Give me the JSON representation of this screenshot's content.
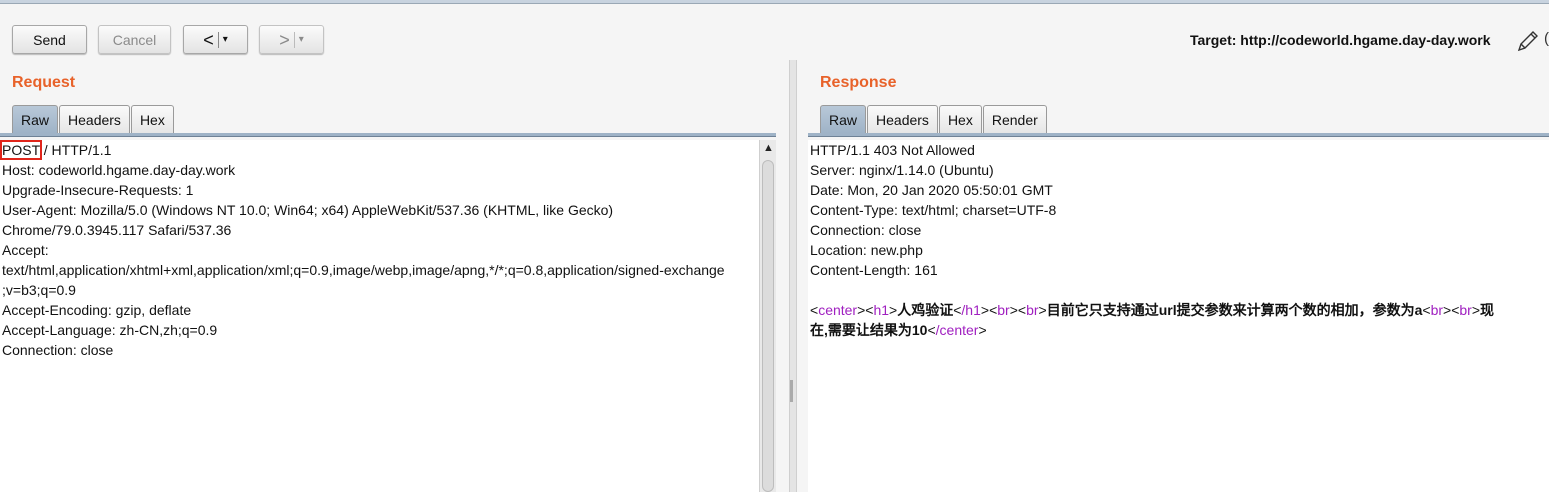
{
  "toolbar": {
    "send_label": "Send",
    "cancel_label": "Cancel",
    "back_label": "<",
    "forward_label": ">",
    "dropdown_label": "▾",
    "target_label": "Target: http://codeworld.hgame.day-day.work"
  },
  "request": {
    "title": "Request",
    "tabs": [
      "Raw",
      "Headers",
      "Hex"
    ],
    "active_tab": "Raw",
    "method": "POST",
    "first_line_rest": " / HTTP/1.1",
    "lines": [
      "Host: codeworld.hgame.day-day.work",
      "Upgrade-Insecure-Requests: 1",
      "User-Agent: Mozilla/5.0 (Windows NT 10.0; Win64; x64) AppleWebKit/537.36 (KHTML, like Gecko)",
      "Chrome/79.0.3945.117 Safari/537.36",
      "Accept:",
      "text/html,application/xhtml+xml,application/xml;q=0.9,image/webp,image/apng,*/*;q=0.8,application/signed-exchange",
      ";v=b3;q=0.9",
      "Accept-Encoding: gzip, deflate",
      "Accept-Language: zh-CN,zh;q=0.9",
      "Connection: close"
    ]
  },
  "response": {
    "title": "Response",
    "tabs": [
      "Raw",
      "Headers",
      "Hex",
      "Render"
    ],
    "active_tab": "Raw",
    "lines": [
      "HTTP/1.1 403 Not Allowed",
      "Server: nginx/1.14.0 (Ubuntu)",
      "Date: Mon, 20 Jan 2020 05:50:01 GMT",
      "Content-Type: text/html; charset=UTF-8",
      "Connection: close",
      "Location: new.php",
      "Content-Length: 161"
    ],
    "body": {
      "tag_center_open": "center",
      "tag_h1_open": "h1",
      "h1_text": "人鸡验证",
      "tag_h1_close": "/h1",
      "tag_br": "br",
      "text1": "目前它只支持通过",
      "text_url": "url",
      "text2": "提交参数来计算两个数的相加，参数为",
      "text_a": "a",
      "text3": "现",
      "text4": "在,需要让结果为",
      "text_10": "10",
      "tag_center_close": "/center"
    }
  },
  "colors": {
    "accent_title": "#e8622a",
    "tag_purple": "#a020c0",
    "highlight_box": "#e0251b",
    "active_tab": "#9fb3c7"
  }
}
